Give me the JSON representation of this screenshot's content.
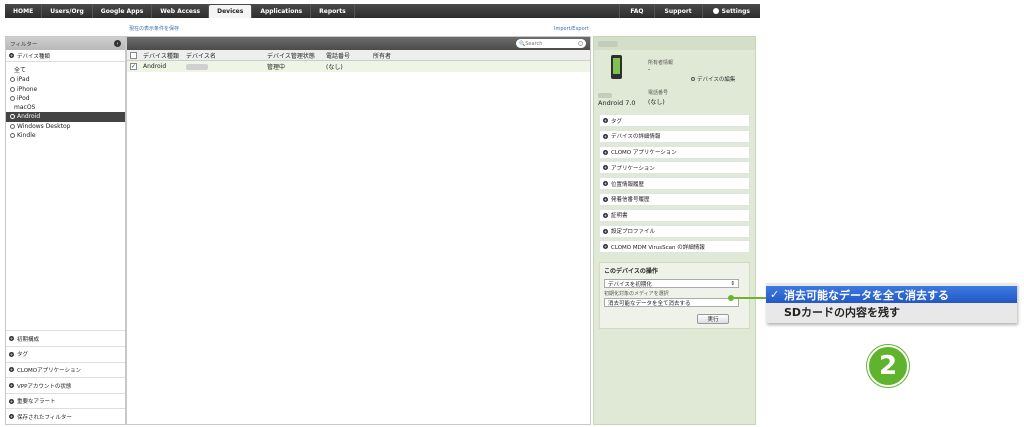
{
  "nav": {
    "items": [
      "HOME",
      "Users/Org",
      "Google Apps",
      "Web Access",
      "Devices",
      "Applications",
      "Reports"
    ],
    "active": "Devices",
    "right": [
      "FAQ",
      "Support",
      "Settings"
    ]
  },
  "links": {
    "save": "現在の表示条件を保存",
    "import": "Import/Export"
  },
  "sidebar": {
    "header": "フィルター",
    "device_type_label": "デバイス種類",
    "filters": [
      "全て",
      "iPad",
      "iPhone",
      "iPod",
      "macOS",
      "Android",
      "Windows Desktop",
      "Kindle"
    ],
    "selected": "Android",
    "bottom_sections": [
      "初期構成",
      "タグ",
      "CLOMOアプリケーション",
      "VPPアカウントの状態",
      "重要なアラート",
      "保存されたフィルター"
    ]
  },
  "table": {
    "search_placeholder": "Search",
    "headers": [
      "デバイス種類",
      "デバイス名",
      "デバイス管理状態",
      "電話番号",
      "所有者"
    ],
    "rows": [
      {
        "checked": "✓",
        "type": "Android",
        "state": "管理中",
        "phone": "(なし)"
      }
    ]
  },
  "detail": {
    "owner_label": "所有者情報",
    "owner_value": "-",
    "edit_label": "デバイスの編集",
    "os": "Android 7.0",
    "phone_label": "電話番号",
    "phone_value": "(なし)",
    "sections": [
      "タグ",
      "デバイスの詳細情報",
      "CLOMO アプリケーション",
      "アプリケーション",
      "位置情報履歴",
      "発着信番号履歴",
      "証明書",
      "設定プロファイル",
      "CLOMO MDM VirusScan の詳細情報"
    ],
    "ops": {
      "title": "このデバイスの操作",
      "select_value": "デバイスを初期化",
      "media_label": "初期化対象のメディアを選択",
      "media_value": "消去可能なデータを全て消去する",
      "exec": "実行"
    }
  },
  "callout": {
    "options": [
      "消去可能なデータを全て消去する",
      "SDカードの内容を残す"
    ],
    "selected_check": "✓",
    "badge": "2"
  },
  "colors": {
    "accent_green": "#5fb32d",
    "select_blue": "#2458c4",
    "panel_green": "#dfe9d5"
  }
}
